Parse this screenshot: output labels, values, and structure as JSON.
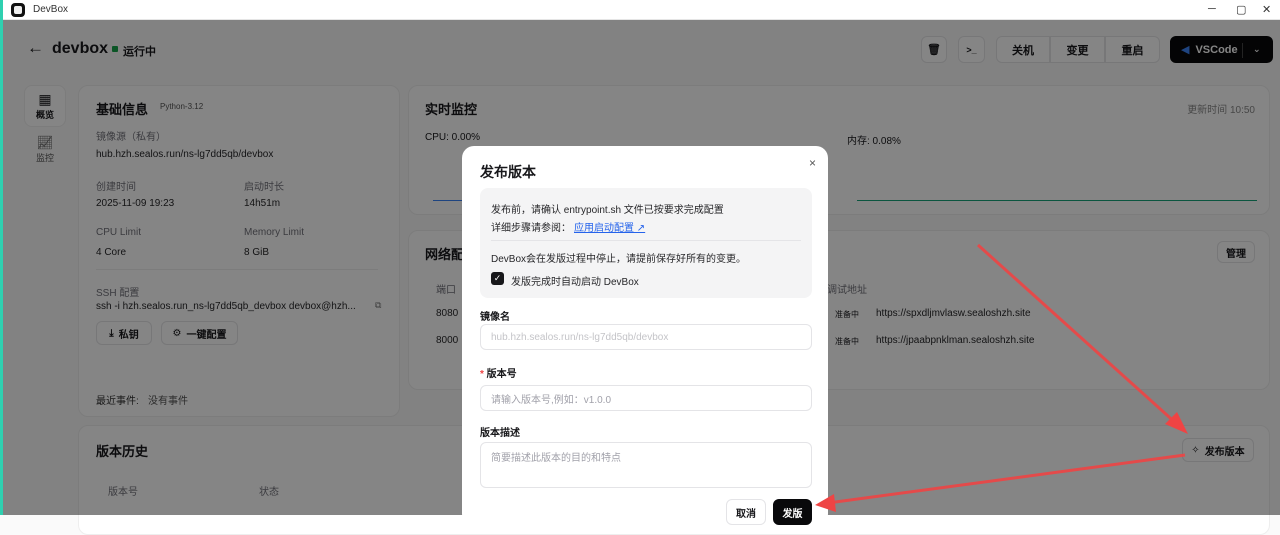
{
  "window": {
    "title": "DevBox",
    "minimize": "─",
    "maximize": "▢",
    "close": "✕"
  },
  "header": {
    "name": "devbox",
    "status": "运行中",
    "status_color": "#16a34a",
    "actions": {
      "shutdown": "关机",
      "change": "变更",
      "restart": "重启",
      "vscode": "VSCode"
    }
  },
  "sidenav": [
    {
      "label": "概览",
      "icon": "grid-icon"
    },
    {
      "label": "监控",
      "icon": "chart-icon"
    }
  ],
  "basic": {
    "title": "基础信息",
    "runtime": "Python-3.12",
    "image_label": "镜像源（私有）",
    "image": "hub.hzh.sealos.run/ns-lg7dd5qb/devbox",
    "created_label": "创建时间",
    "created": "2025-11-09 19:23",
    "uptime_label": "启动时长",
    "uptime": "14h51m",
    "cpu_label": "CPU Limit",
    "cpu": "4 Core",
    "mem_label": "Memory Limit",
    "mem": "8 GiB",
    "ssh_label": "SSH 配置",
    "ssh": "ssh -i hzh.sealos.run_ns-lg7dd5qb_devbox devbox@hzh...",
    "key_btn": "私钥",
    "config_btn": "一键配置",
    "events_label": "最近事件:",
    "events": "没有事件"
  },
  "monitor": {
    "title": "实时监控",
    "updated": "更新时间 10:50",
    "cpu": "CPU: 0.00%",
    "mem": "内存: 0.08%"
  },
  "network": {
    "title": "网络配置",
    "manage": "管理",
    "col_port": "端口",
    "col_addr": "调试地址",
    "rows": [
      {
        "port": "8080",
        "status": "准备中",
        "url": "https://spxdljmvlasw.sealoshzh.site"
      },
      {
        "port": "8000",
        "status": "准备中",
        "url": "https://jpaabpnklman.sealoshzh.site"
      }
    ]
  },
  "history": {
    "title": "版本历史",
    "publish": "发布版本",
    "col_version": "版本号",
    "col_status": "状态"
  },
  "modal": {
    "title": "发布版本",
    "notice1": "发布前，请确认 entrypoint.sh 文件已按要求完成配置",
    "notice2": "详细步骤请参阅：",
    "link": "应用启动配置 ↗",
    "notice3": "DevBox会在发版过程中停止，请提前保存好所有的变更。",
    "checkbox": "发版完成时自动启动 DevBox",
    "checked": true,
    "image_label": "镜像名",
    "image_value": "hub.hzh.sealos.run/ns-lg7dd5qb/devbox",
    "version_label": "版本号",
    "version_placeholder": "请输入版本号,例如：v1.0.0",
    "desc_label": "版本描述",
    "desc_placeholder": "简要描述此版本的目的和特点",
    "cancel": "取消",
    "submit": "发版"
  }
}
